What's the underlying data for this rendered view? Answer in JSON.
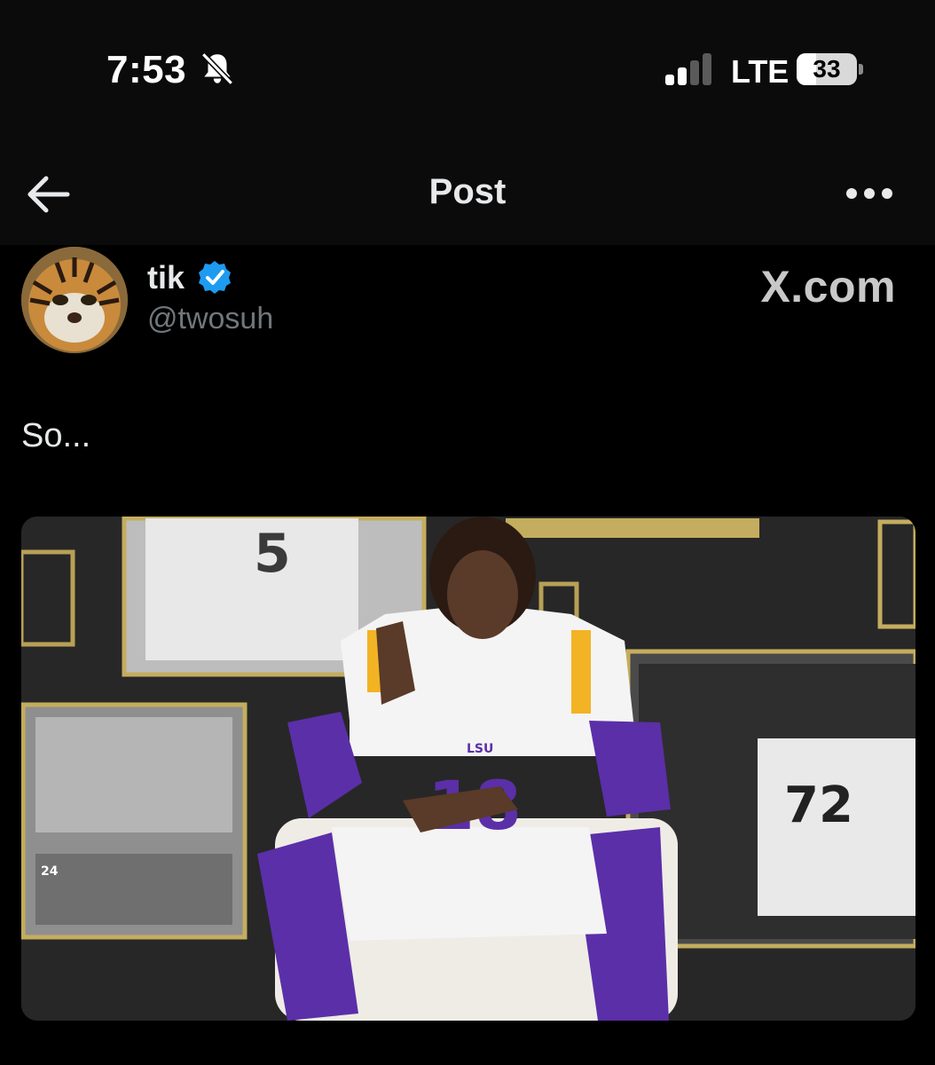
{
  "status_bar": {
    "time": "7:53",
    "silent_icon": "bell-slash-icon",
    "signal_icon": "cellular-signal-icon",
    "signal_bars_active": 2,
    "signal_bars_total": 4,
    "network": "LTE",
    "battery_level": "33",
    "battery_fraction": 0.33
  },
  "nav": {
    "back_icon": "arrow-left-icon",
    "title": "Post",
    "more_icon": "more-horizontal-icon"
  },
  "post": {
    "author_name": "tik",
    "verified_icon": "verified-badge-icon",
    "handle": "@twosuh",
    "watermark": "X.com",
    "text": "So...",
    "image_jersey_numbers": [
      "5",
      "18",
      "72",
      "24"
    ],
    "image_chest_text": "LSU"
  },
  "colors": {
    "background": "#000000",
    "bar_background": "#0b0b0c",
    "text_primary": "#e7e9ea",
    "text_secondary": "#71767b",
    "verified_blue": "#1d9bf0",
    "lsu_purple": "#5b2fa8",
    "lsu_gold": "#f2b324"
  }
}
